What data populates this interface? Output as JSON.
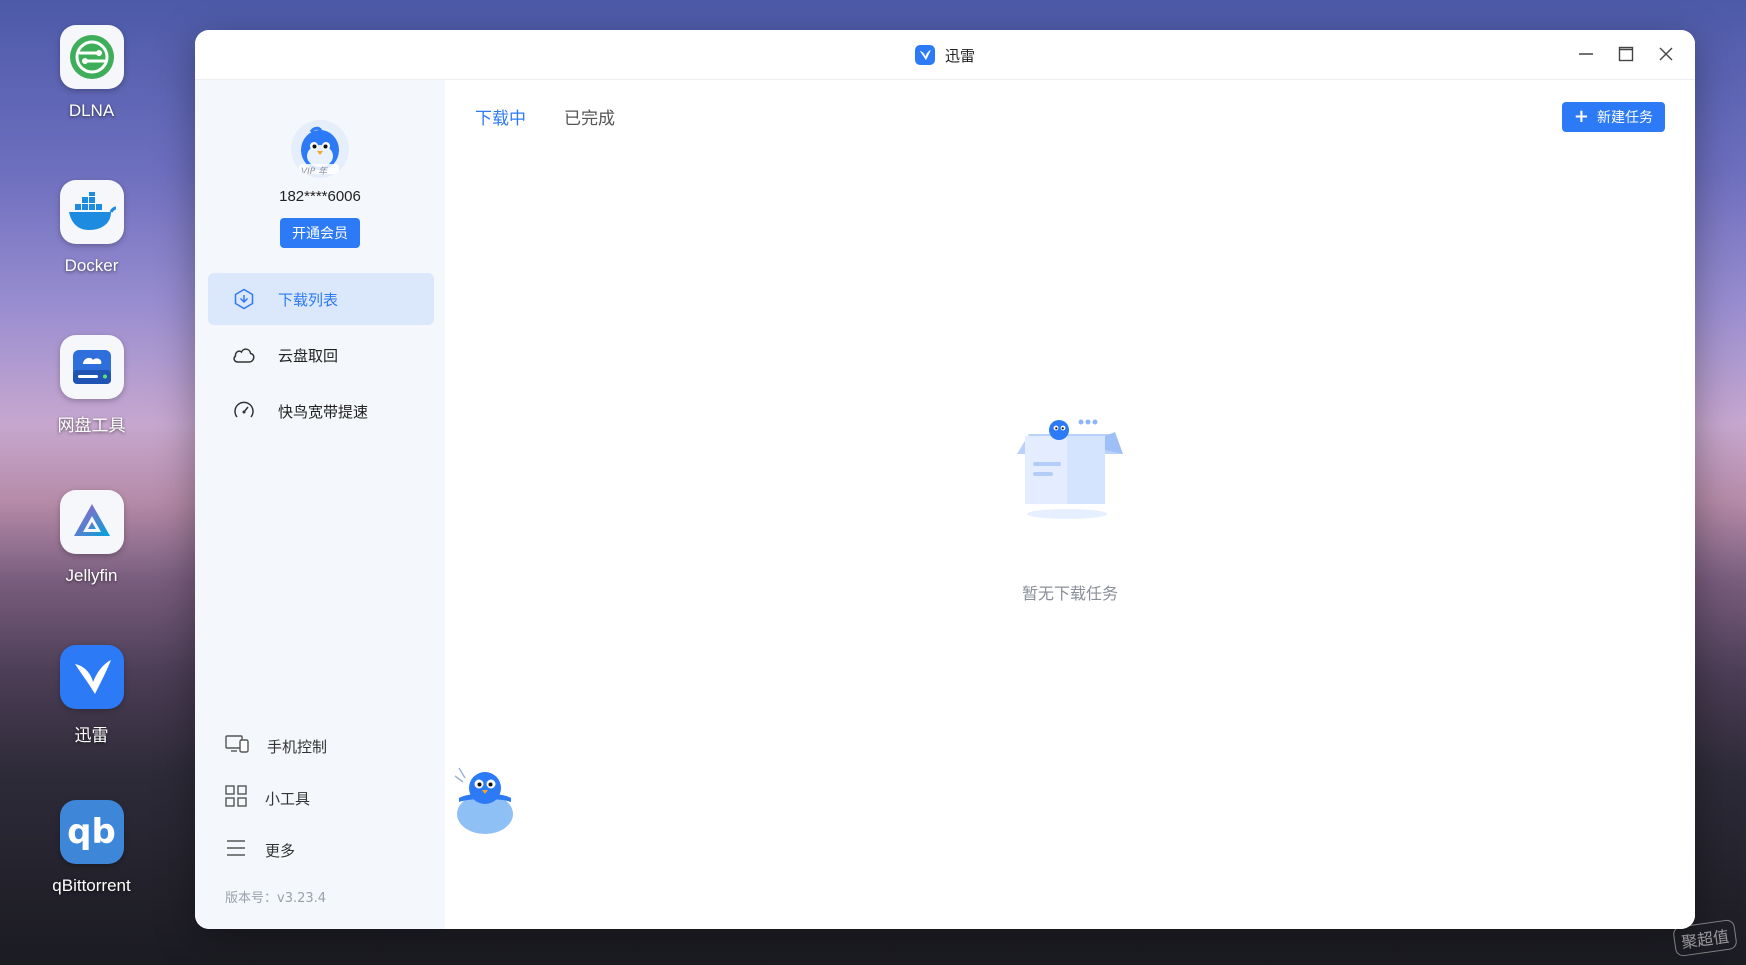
{
  "desktop": {
    "apps": [
      {
        "label": "DLNA",
        "icon": "dlna-icon"
      },
      {
        "label": "Docker",
        "icon": "docker-icon"
      },
      {
        "label": "网盘工具",
        "icon": "cloud-drive-icon"
      },
      {
        "label": "Jellyfin",
        "icon": "jellyfin-icon"
      },
      {
        "label": "迅雷",
        "icon": "thunder-icon"
      },
      {
        "label": "qBittorrent",
        "icon": "qbittorrent-icon"
      }
    ]
  },
  "window": {
    "title": "迅雷",
    "accent": "#2d7af6"
  },
  "sidebar": {
    "avatar_badge": "VIP 年",
    "phone": "182****6006",
    "vip_button": "开通会员",
    "nav": [
      {
        "label": "下载列表",
        "icon": "download-icon",
        "active": true
      },
      {
        "label": "云盘取回",
        "icon": "cloud-icon",
        "active": false
      },
      {
        "label": "快鸟宽带提速",
        "icon": "speedometer-icon",
        "active": false
      }
    ],
    "bottom": [
      {
        "label": "手机控制",
        "icon": "devices-icon"
      },
      {
        "label": "小工具",
        "icon": "grid-icon"
      },
      {
        "label": "更多",
        "icon": "menu-icon"
      }
    ],
    "version": "版本号：v3.23.4"
  },
  "main": {
    "tabs": [
      {
        "label": "下载中",
        "active": true
      },
      {
        "label": "已完成",
        "active": false
      }
    ],
    "new_task_button": "新建任务",
    "empty_text": "暂无下载任务"
  },
  "watermark": "聚超值"
}
